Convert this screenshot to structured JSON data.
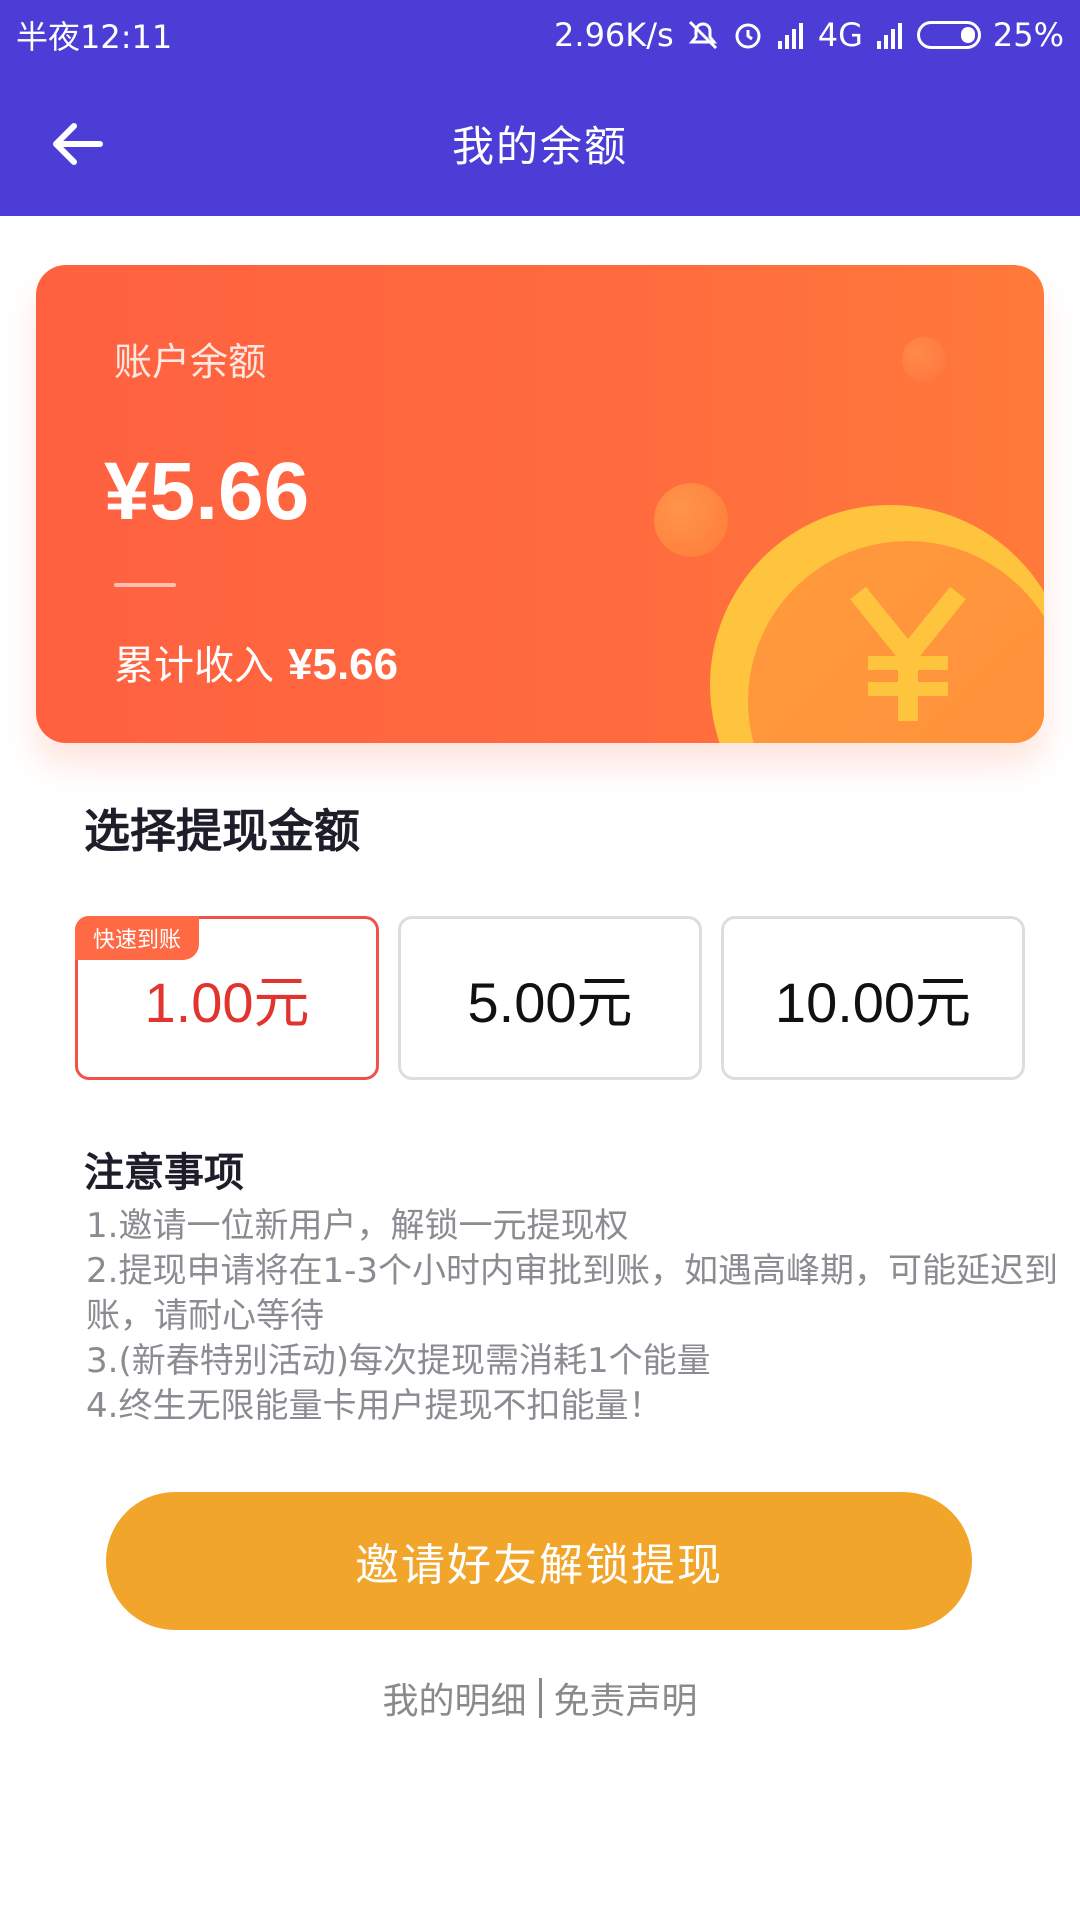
{
  "status_bar": {
    "time": "半夜12:11",
    "network_speed": "2.96K/s",
    "network_type": "4G",
    "battery": "25%"
  },
  "header": {
    "title": "我的余额",
    "back_icon": "arrow-left-icon"
  },
  "balance_card": {
    "label": "账户余额",
    "amount": "¥5.66",
    "cumulative_label": "累计收入",
    "cumulative_value": "¥5.66",
    "coin_symbol": "¥"
  },
  "withdraw": {
    "title": "选择提现金额",
    "options": [
      {
        "label": "1.00元",
        "badge": "快速到账",
        "selected": true
      },
      {
        "label": "5.00元",
        "selected": false
      },
      {
        "label": "10.00元",
        "selected": false
      }
    ]
  },
  "notes": {
    "title": "注意事项",
    "items": [
      "1.邀请一位新用户，解锁一元提现权",
      "2.提现申请将在1-3个小时内审批到账，如遇高峰期，可能延迟到账，请耐心等待",
      "3.(新春特别活动)每次提现需消耗1个能量",
      "4.终生无限能量卡用户提现不扣能量！"
    ]
  },
  "cta": {
    "label": "邀请好友解锁提现"
  },
  "footer": {
    "details_link": "我的明细",
    "disclaimer_link": "免责声明"
  },
  "colors": {
    "header_bg": "#4B3DD6",
    "card_bg": "#FF6140",
    "selected_border": "#F0524B",
    "cta_bg": "#F1A52A"
  }
}
